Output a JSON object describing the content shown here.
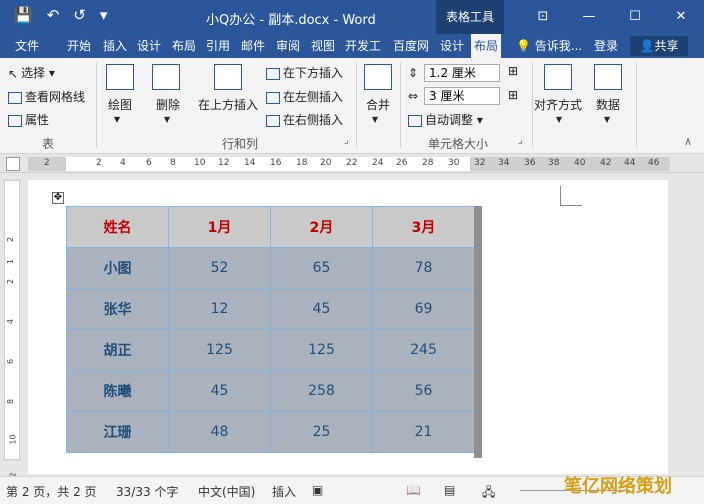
{
  "titlebar": {
    "title": "小Q办公 - 副本.docx - Word",
    "context_tab": "表格工具",
    "qat": [
      "💾",
      "↶",
      "↺",
      "▾"
    ],
    "win_buttons": [
      "⊡",
      "—",
      "☐",
      "✕"
    ]
  },
  "tabs": [
    "文件",
    "开始",
    "插入",
    "设计",
    "布局",
    "引用",
    "邮件",
    "审阅",
    "视图",
    "开发工",
    "百度网",
    "设计",
    "布局"
  ],
  "tell_me": "💡 告诉我...",
  "login": "登录",
  "share": "共享",
  "ribbon": {
    "select": "选择",
    "view_gridlines": "查看网格线",
    "properties": "属性",
    "group_table": "表",
    "draw": "绘图",
    "delete": "删除",
    "insert_above": "在上方插入",
    "insert_below": "在下方插入",
    "insert_left": "在左侧插入",
    "insert_right": "在右侧插入",
    "group_rows_cols": "行和列",
    "merge": "合并",
    "height_value": "1.2 厘米",
    "width_value": "3 厘米",
    "auto_adjust": "自动调整",
    "group_cell_size": "单元格大小",
    "align": "对齐方式",
    "data": "数据"
  },
  "ruler_ticks": [
    "2",
    "2",
    "4",
    "6",
    "8",
    "10",
    "12",
    "14",
    "16",
    "18",
    "20",
    "22",
    "24",
    "26",
    "28",
    "30",
    "32",
    "34",
    "36",
    "38",
    "40",
    "42",
    "44",
    "46"
  ],
  "vruler_ticks": [
    "2",
    "1",
    "2",
    "4",
    "6",
    "8",
    "10",
    "12"
  ],
  "table": {
    "header": [
      "姓名",
      "1月",
      "2月",
      "3月"
    ],
    "rows": [
      [
        "小图",
        "52",
        "65",
        "78"
      ],
      [
        "张华",
        "12",
        "45",
        "69"
      ],
      [
        "胡正",
        "125",
        "125",
        "245"
      ],
      [
        "陈曦",
        "45",
        "258",
        "56"
      ],
      [
        "江珊",
        "48",
        "25",
        "21"
      ]
    ]
  },
  "status": {
    "page": "第 2 页，共 2 页",
    "words": "33/33 个字",
    "lang": "中文(中国)",
    "mode": "插入"
  },
  "watermark": "笔亿网络策划"
}
